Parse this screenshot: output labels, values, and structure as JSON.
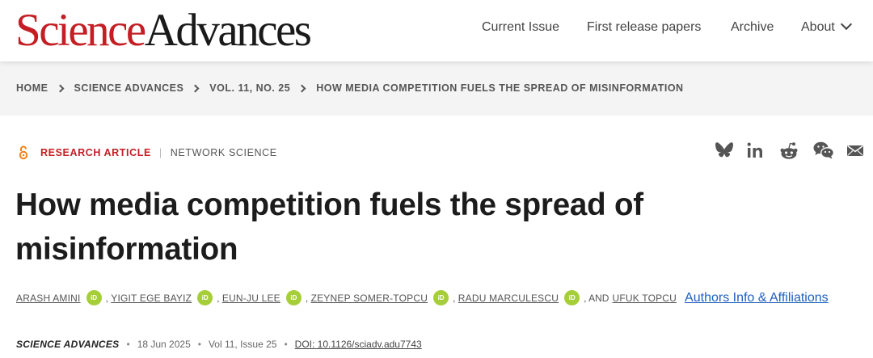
{
  "header": {
    "logo_part1": "Science",
    "logo_part2": "Advances",
    "nav": {
      "current_issue": "Current Issue",
      "first_release": "First release papers",
      "archive": "Archive",
      "about": "About"
    }
  },
  "breadcrumb": {
    "items": [
      "HOME",
      "SCIENCE ADVANCES",
      "VOL. 11, NO. 25",
      "HOW MEDIA COMPETITION FUELS THE SPREAD OF MISINFORMATION"
    ]
  },
  "article": {
    "type": "RESEARCH ARTICLE",
    "subject": "NETWORK SCIENCE",
    "title": "How media competition fuels the spread of misinformation",
    "authors": [
      "ARASH AMINI",
      "YIGIT EGE BAYIZ",
      "EUN-JU LEE",
      "ZEYNEP SOMER-TOPCU",
      "RADU MARCULESCU",
      "UFUK TOPCU"
    ],
    "and_label": ", AND",
    "orcid_label": "iD",
    "affiliations_link": "Authors Info & Affiliations",
    "citation": {
      "journal": "SCIENCE ADVANCES",
      "date": "18 Jun 2025",
      "volume": "Vol 11, Issue 25",
      "doi": "DOI: 10.1126/sciadv.adu7743"
    }
  },
  "share_icons": [
    "bluesky-icon",
    "linkedin-icon",
    "reddit-icon",
    "wechat-icon",
    "email-icon"
  ],
  "colors": {
    "brand_red": "#c41e24",
    "orcid_green": "#a6ce39",
    "link_blue": "#1f5fbf",
    "open_access_orange": "#f68212"
  }
}
